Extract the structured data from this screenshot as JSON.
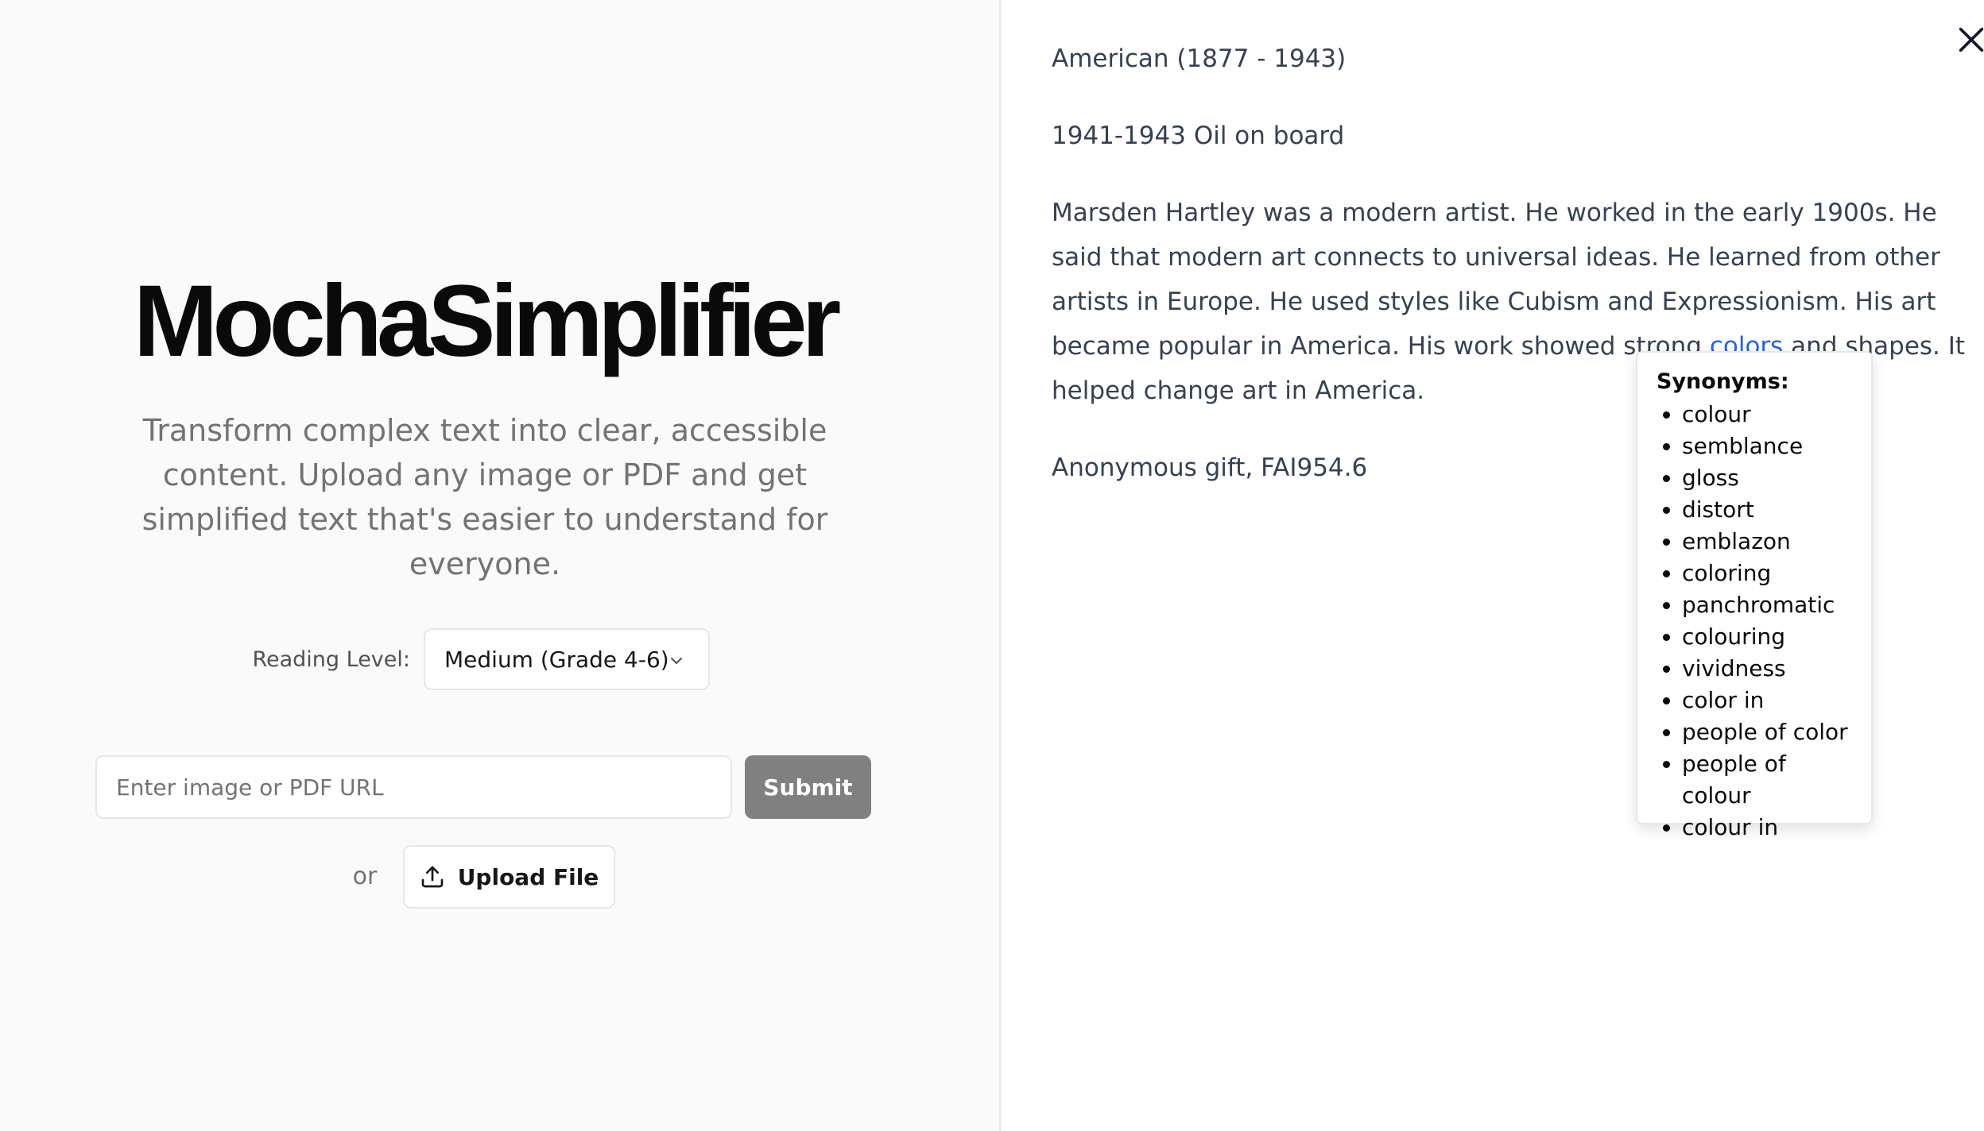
{
  "app": {
    "title": "MochaSimplifier",
    "tagline": "Transform complex text into clear, accessible content. Upload any image or PDF and get simplified text that's easier to understand for everyone."
  },
  "reading_level": {
    "label": "Reading Level:",
    "selected": "Medium (Grade 4-6)"
  },
  "url_input": {
    "placeholder": "Enter image or PDF URL",
    "value": ""
  },
  "submit_label": "Submit",
  "or_label": "or",
  "upload_label": "Upload File",
  "result": {
    "line1": "American (1877 - 1943)",
    "line2": "1941-1943 Oil on board",
    "paragraph_before": "Marsden Hartley was a modern artist. He worked in the early 1900s. He said that modern art connects to universal ideas. He learned from other artists in Europe. He used styles like Cubism and Expressionism. His art became popular in America. His work showed strong ",
    "highlight_word": "colors",
    "paragraph_after": " and shapes. It helped change art in America.",
    "credit": "Anonymous gift, FAI954.6"
  },
  "synonyms": {
    "heading": "Synonyms:",
    "items": [
      "colour",
      "semblance",
      "gloss",
      "distort",
      "emblazon",
      "coloring",
      "panchromatic",
      "colouring",
      "vividness",
      "color in",
      "people of color",
      "people of colour",
      "colour in"
    ]
  },
  "icons": {
    "upload": "upload-icon",
    "close": "close-icon",
    "chevron": "chevron-down-icon"
  },
  "colors": {
    "accent_link": "#2563eb",
    "submit_bg": "#808080",
    "left_bg": "#fafafa"
  }
}
